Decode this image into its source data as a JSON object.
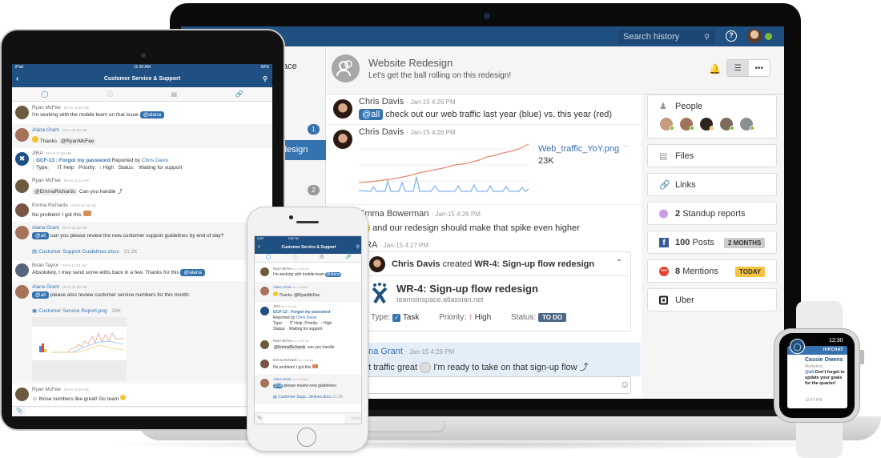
{
  "laptop": {
    "search": {
      "placeholder": "Search history",
      "icon": "search-icon"
    },
    "help_icon": "?",
    "leftnav": {
      "items": [
        {
          "label": "ace"
        },
        {
          "label": "",
          "badge": "1"
        },
        {
          "label": "t"
        },
        {
          "label": "design",
          "selected": true
        },
        {
          "label": "",
          "badge": "2"
        }
      ]
    },
    "room": {
      "title": "Website Redesign",
      "topic": "Let's get the ball rolling on this redesign!"
    },
    "messages": [
      {
        "name": "Chris Davis",
        "time": "Jan-15 4:26 PM",
        "mention": "@all",
        "text": "check out our web traffic last year (blue) vs. this year (red)"
      },
      {
        "name": "Chris Davis",
        "time": "Jan-15 4:26 PM",
        "attachment": "Web_traffic_YoY.png",
        "size": "23K"
      },
      {
        "name": "Emma Bowerman",
        "time": "Jan-15 4:26 PM",
        "text": "and our redesign should make that spike even higher"
      },
      {
        "name": "RA",
        "time": "Jan-15 4:27 PM",
        "card": {
          "header_actor": "Chris Davis",
          "header_verb": "created",
          "header_issue": "WR-4: Sign-up flow redesign",
          "title": "WR-4: Sign-up flow redesign",
          "site": "teamsinspace.atlassian.net",
          "type_label": "Type:",
          "type": "Task",
          "priority_label": "Priority:",
          "priority": "High",
          "status_label": "Status:",
          "status": "TO DO"
        }
      },
      {
        "name": "ana Grant",
        "time": "Jan-15 4:28 PM",
        "text_a": "at traffic great",
        "text_b": "I'm ready to take on that sign-up flow"
      }
    ],
    "sidebar": {
      "people_label": "People",
      "files_label": "Files",
      "links_label": "Links",
      "standup": {
        "count": "2",
        "label": "Standup reports"
      },
      "posts": {
        "count": "100",
        "label": "Posts",
        "pill": "2 MONTHS"
      },
      "mentions": {
        "count": "8",
        "label": "Mentions",
        "pill": "TODAY"
      },
      "uber_label": "Uber"
    },
    "colors": {
      "brand": "#205081",
      "accent": "#3572b0",
      "online": "#7dbb35",
      "today": "#f6c342"
    }
  },
  "ipad": {
    "status": {
      "carrier": "iPad",
      "time": "11:30 AM",
      "battery": "82%"
    },
    "title": "Customer Service & Support",
    "messages": [
      {
        "name": "Ryan McFee",
        "time": "Oct-9 11:20 AM",
        "text": "I'm working with the mobile team on that issue",
        "mention": "@alana"
      },
      {
        "name": "Alana Grant",
        "time": "Oct-9 11:20 AM",
        "text": "Thanks",
        "mention": "@RyanMcFee"
      },
      {
        "name": "JIRA",
        "time": "Oct-9 11:20 AM",
        "issue": "GCF-13 : Forgot my password",
        "reported_by": "Reported by",
        "reporter": "Chris Davis",
        "details": "Type:      IT Help   Priority:  ↑ High   Status:   Waiting for support"
      },
      {
        "name": "Ryan McFee",
        "time": "Oct-9 11:21 AM",
        "mention": "@EmmaRichards",
        "text": "Can you handle"
      },
      {
        "name": "Emma Richards",
        "time": "Oct-9 11:21 AM",
        "text": "No problem! I got this"
      },
      {
        "name": "Alana Grant",
        "time": "Oct-9 11:22 AM",
        "mention": "@all",
        "text": "can you please review the new customer support guidelines by end of day?",
        "file": "Customer Support Guidelines.docx",
        "size": "21.2K"
      },
      {
        "name": "Brian Taylor",
        "time": "Oct-9 11:23 AM",
        "text": "Absolutely. I may send some edits back in a few. Thanks for this",
        "mention": "@alana"
      },
      {
        "name": "Alana Grant",
        "time": "Oct-9 11:29 AM",
        "mention": "@all",
        "text": "please also review customer service numbers for this month:",
        "file": "Customer Service Report.png",
        "size": "29K"
      },
      {
        "name": "Ryan McFee",
        "time": "Oct-9 11:30 AM",
        "text": "those numbers like great! Go team"
      }
    ]
  },
  "iphone": {
    "status": {
      "carrier": "AT&T",
      "time": "3:58 PM"
    },
    "title": "Customer Service & Support",
    "messages": [
      {
        "name": "Ryan McFee",
        "time": "Oct-7 3:53 PM",
        "text": "I'm working with mobile team",
        "mention": "@alana"
      },
      {
        "name": "Alana Grant",
        "time": "Oct-7 3:53 PM",
        "text": "Thanks",
        "mention": "@RyanMcFee"
      },
      {
        "name": "JIRA",
        "time": "Oct-7 3:54 PM",
        "issue": "GCF-12 : Forgot my password",
        "reported_by": "Reported by",
        "reporter": "Chris Davis",
        "line1": "Type:      IT Help  Priority:  ↑ High",
        "line2": "Status:   Waiting for support"
      },
      {
        "name": "Ryan McFee",
        "time": "Oct-7 3:54 PM",
        "mention": "@EmmaRichards",
        "text": "can you handle"
      },
      {
        "name": "Emma Richards",
        "time": "Oct-7 3:54 PM",
        "text": "No problem! I got this"
      },
      {
        "name": "Alana Grant",
        "time": "Oct-7 3:55 PM",
        "mention": "@all",
        "text": "please review new guidelines:",
        "file": "Customer Supp...delines.docx",
        "size": "21.2K"
      }
    ],
    "send_label": "Send"
  },
  "watch": {
    "time": "12:30",
    "app": "HIPCHAT",
    "sender": "Cassie Owens",
    "dept": "Marketing",
    "mention": "@all",
    "text": "Don't forget to update your goals for the quarter!",
    "msg_time": "12:47 PM"
  }
}
